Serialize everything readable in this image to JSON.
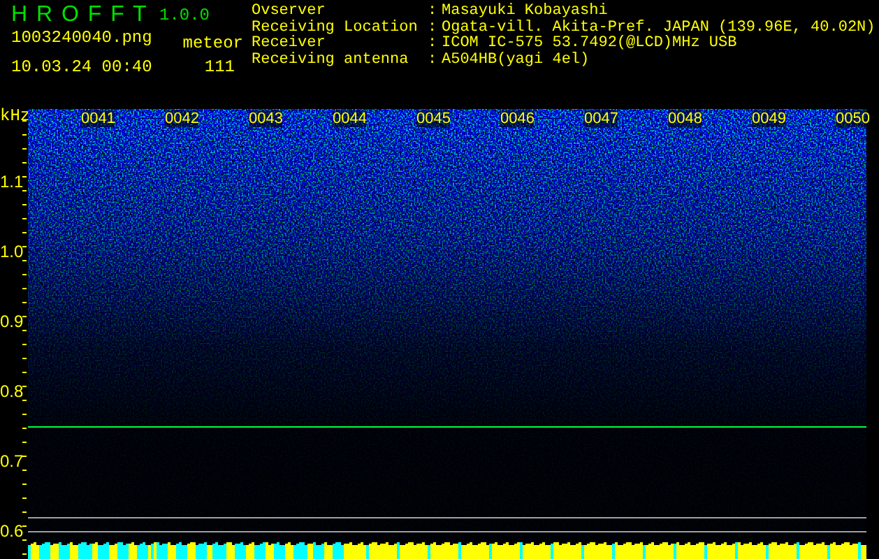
{
  "app": {
    "name": "H R O F F T",
    "version": "1.0.0"
  },
  "file": "1003240040.png",
  "timestamp": "10.03.24 00:40",
  "meteor": {
    "label": "meteor",
    "count": "111"
  },
  "info": [
    {
      "label": "Ovserver",
      "separator": ":",
      "value": "Masayuki Kobayashi"
    },
    {
      "label": "Receiving Location",
      "separator": ":",
      "value": "Ogata-vill. Akita-Pref. JAPAN (139.96E, 40.02N)"
    },
    {
      "label": "Receiver",
      "separator": ":",
      "value": "ICOM IC-575 53.7492(@LCD)MHz USB"
    },
    {
      "label": "Receiving antenna",
      "separator": ":",
      "value": "A504HB(yagi 4el)"
    }
  ],
  "spectrogram": {
    "unit": "kHz",
    "time_labels": [
      "0041",
      "0042",
      "0043",
      "0044",
      "0045",
      "0046",
      "0047",
      "0048",
      "0049",
      "0050"
    ],
    "freq_labels": [
      "1.1",
      "1.0",
      "0.9",
      "0.8",
      "0.7",
      "0.6"
    ]
  }
}
